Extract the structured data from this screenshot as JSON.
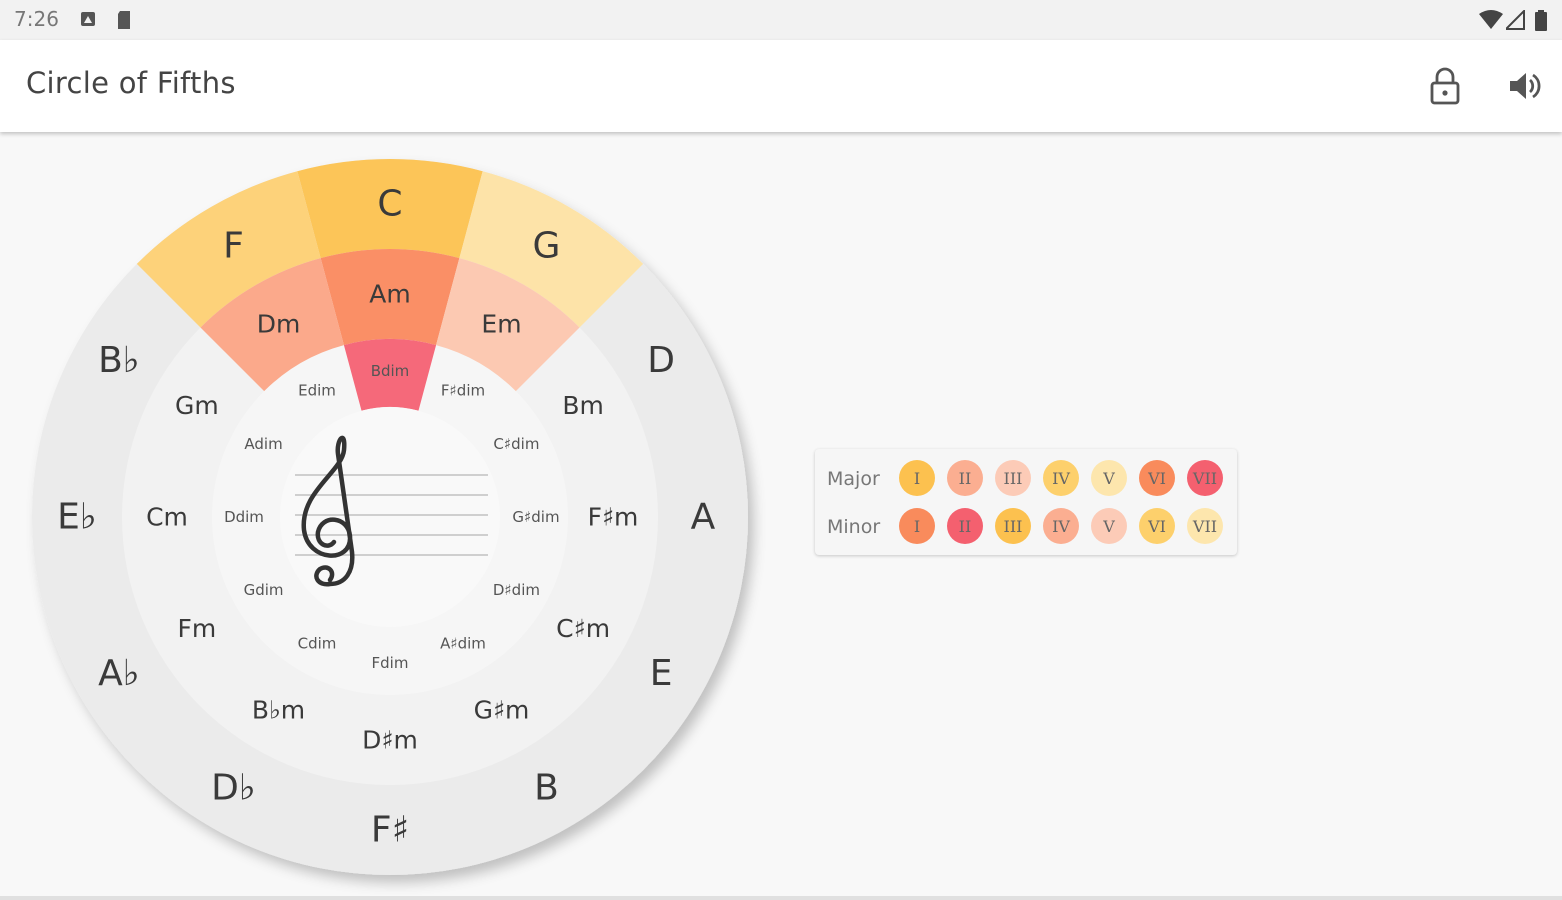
{
  "status_bar": {
    "time": "7:26",
    "left_icons": [
      "screenshot-icon",
      "sd-card-icon"
    ],
    "right_icons": [
      "wifi-icon",
      "signal-icon",
      "battery-icon"
    ]
  },
  "app_bar": {
    "title": "Circle of Fifths",
    "actions": [
      {
        "name": "lock-icon"
      },
      {
        "name": "volume-icon"
      }
    ]
  },
  "wheel": {
    "major_keys": [
      "C",
      "G",
      "D",
      "A",
      "E",
      "B",
      "F♯",
      "D♭",
      "A♭",
      "E♭",
      "B♭",
      "F"
    ],
    "minor_keys": [
      "Am",
      "Em",
      "Bm",
      "F♯m",
      "C♯m",
      "G♯m",
      "D♯m",
      "B♭m",
      "Fm",
      "Cm",
      "Gm",
      "Dm"
    ],
    "dim_keys": [
      "Bdim",
      "F♯dim",
      "C♯dim",
      "G♯dim",
      "D♯dim",
      "A♯dim",
      "Fdim",
      "Cdim",
      "Gdim",
      "Ddim",
      "Adim",
      "Edim"
    ],
    "center_icon": "treble-clef-staff-icon",
    "colors": {
      "outer_ring": "#ebebeb",
      "middle_ring": "#f2f2f2",
      "inner_ring": "#f6f6f6",
      "center": "#f9f9f9",
      "major_I": "#fcc558",
      "major_IV": "#fdd27a",
      "major_V": "#fde3a8",
      "minor_ii": "#fba98b",
      "minor_vi": "#fa8f66",
      "minor_iii": "#fcc9b2",
      "dim_vii": "#f5697a"
    }
  },
  "legend": {
    "major_label": "Major",
    "minor_label": "Minor",
    "major_degrees": [
      {
        "label": "I",
        "color": "#fcc14f"
      },
      {
        "label": "II",
        "color": "#fbae91"
      },
      {
        "label": "III",
        "color": "#fccbb7"
      },
      {
        "label": "IV",
        "color": "#fdd06c"
      },
      {
        "label": "V",
        "color": "#fde6ad"
      },
      {
        "label": "VI",
        "color": "#f98b5c"
      },
      {
        "label": "VII",
        "color": "#f4606f"
      }
    ],
    "minor_degrees": [
      {
        "label": "I",
        "color": "#f98b5c"
      },
      {
        "label": "II",
        "color": "#f4606f"
      },
      {
        "label": "III",
        "color": "#fcc14f"
      },
      {
        "label": "IV",
        "color": "#fbae91"
      },
      {
        "label": "V",
        "color": "#fccbb7"
      },
      {
        "label": "VI",
        "color": "#fdd06c"
      },
      {
        "label": "VII",
        "color": "#fde6ad"
      }
    ]
  }
}
